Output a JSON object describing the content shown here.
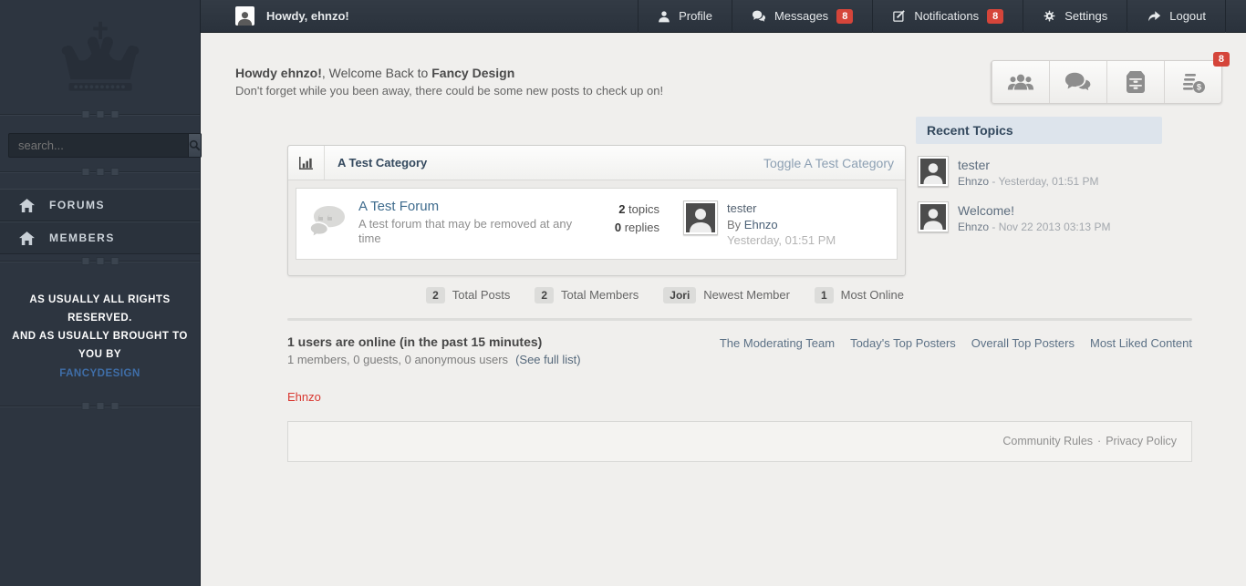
{
  "sidebar": {
    "search_placeholder": "search...",
    "nav": [
      {
        "label": "FORUMS"
      },
      {
        "label": "MEMBERS"
      }
    ],
    "rights_line1": "AS USUALLY ALL RIGHTS RESERVED.",
    "rights_line2": "AND AS USUALLY BROUGHT TO YOU BY",
    "rights_link": "FANCYDESIGN"
  },
  "topbar": {
    "greeting": "Howdy, ehnzo!",
    "menu": [
      {
        "label": "Profile"
      },
      {
        "label": "Messages",
        "badge": "8"
      },
      {
        "label": "Notifications",
        "badge": "8"
      },
      {
        "label": "Settings"
      },
      {
        "label": "Logout"
      }
    ]
  },
  "welcome": {
    "title_bold1": "Howdy ehnzo!",
    "title_mid": ", Welcome Back to ",
    "title_bold2": "Fancy Design",
    "subtitle": "Don't forget while you been away, there could be some new posts to check up on!",
    "quick_badge": "8"
  },
  "category": {
    "title": "A Test Category",
    "toggle_label": "Toggle A Test Category",
    "forum": {
      "name": "A Test Forum",
      "description": "A test forum that may be removed at any time",
      "topics_count": "2",
      "topics_label": " topics",
      "replies_count": "0",
      "replies_label": " replies",
      "last_post_title": "tester",
      "by_prefix": "By ",
      "last_post_author": "Ehnzo",
      "last_post_time": "Yesterday, 01:51 PM"
    }
  },
  "stats": [
    {
      "value": "2",
      "label": "Total Posts"
    },
    {
      "value": "2",
      "label": "Total Members"
    },
    {
      "value": "Jori",
      "label": "Newest Member"
    },
    {
      "value": "1",
      "label": "Most Online"
    }
  ],
  "recent_topics": {
    "title": "Recent Topics",
    "items": [
      {
        "title": "tester",
        "author": "Ehnzo",
        "time": " - Yesterday, 01:51 PM"
      },
      {
        "title": "Welcome!",
        "author": "Ehnzo",
        "time": " - Nov 22 2013 03:13 PM"
      }
    ]
  },
  "online": {
    "headline": "1 users are online (in the past 15 minutes)",
    "detail": "1 members, 0 guests, 0 anonymous users",
    "see_full_list": "(See full list)",
    "online_user": "Ehnzo"
  },
  "footer_links": [
    "The Moderating Team",
    "Today's Top Posters",
    "Overall Top Posters",
    "Most Liked Content"
  ],
  "legal": {
    "community_rules": "Community Rules",
    "separator": "·",
    "privacy_policy": "Privacy Policy"
  },
  "colors": {
    "badge_red": "#d5453a",
    "accent": "#34495e",
    "online_red": "#d93831"
  }
}
